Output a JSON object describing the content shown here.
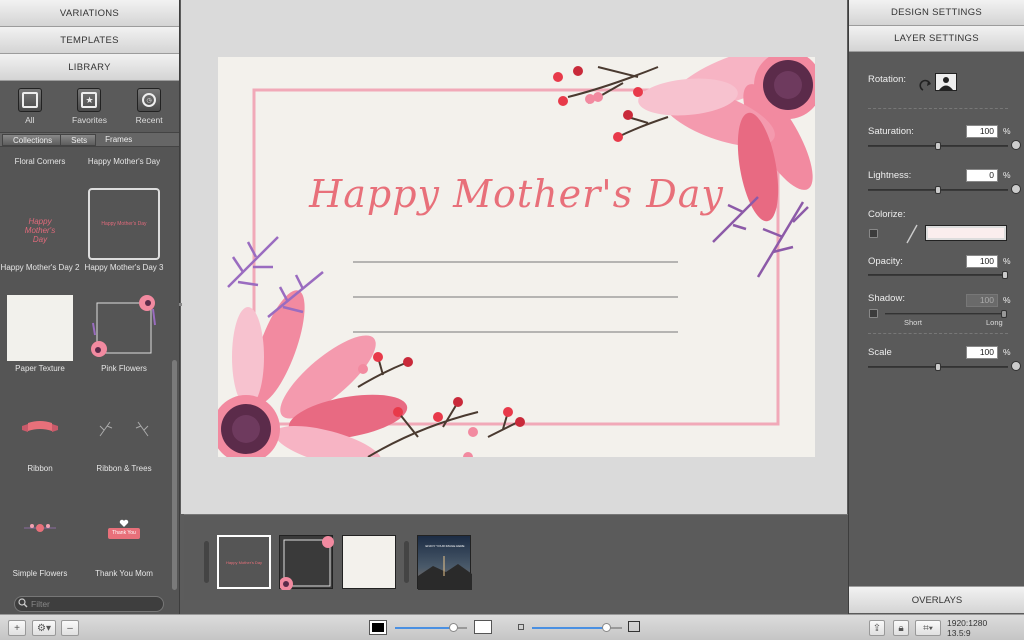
{
  "left_panel": {
    "tabs": [
      "VARIATIONS",
      "TEMPLATES",
      "LIBRARY"
    ],
    "library_filters": [
      {
        "label": "All",
        "icon": "square-icon"
      },
      {
        "label": "Favorites",
        "icon": "star-icon"
      },
      {
        "label": "Recent",
        "icon": "clock-icon"
      }
    ],
    "breadcrumb": [
      "Collections",
      "Sets",
      "Frames"
    ],
    "items": [
      {
        "label": "Floral Corners"
      },
      {
        "label": "Happy Mother's Day"
      },
      {
        "label": "Happy Mother's Day 2",
        "thumb_text": "Happy Mother's Day"
      },
      {
        "label": "Happy Mother's Day 3",
        "thumb_text": "Happy Mother's Day"
      },
      {
        "label": "Paper Texture"
      },
      {
        "label": "Pink Flowers"
      },
      {
        "label": "Ribbon"
      },
      {
        "label": "Ribbon & Trees"
      },
      {
        "label": "Simple Flowers"
      },
      {
        "label": "Thank You Mom",
        "thumb_text": "Thank You"
      }
    ],
    "filter_placeholder": "Filter"
  },
  "canvas": {
    "card_title": "Happy Mother's Day",
    "accent_color": "#e8707a"
  },
  "strip": {
    "last_thumb_text": "ENJOY YOUR IMAGE HERE"
  },
  "right_panel": {
    "tabs": [
      "DESIGN SETTINGS",
      "LAYER SETTINGS"
    ],
    "rotation_label": "Rotation:",
    "saturation": {
      "label": "Saturation:",
      "value": "100",
      "unit": "%",
      "level": 0.5
    },
    "lightness": {
      "label": "Lightness:",
      "value": "0",
      "unit": "%",
      "level": 0.5
    },
    "colorize": {
      "label": "Colorize:",
      "swatch": "#fbeeee"
    },
    "opacity": {
      "label": "Opacity:",
      "value": "100",
      "unit": "%",
      "level": 1.0
    },
    "shadow": {
      "label": "Shadow:",
      "value": "100",
      "unit": "%",
      "short": "Short",
      "long": "Long"
    },
    "scale": {
      "label": "Scale",
      "value": "100",
      "unit": "%",
      "level": 0.5
    },
    "overlays_label": "OVERLAYS"
  },
  "bottom_bar": {
    "resolution": "1920:1280",
    "ratio": "13.5:9"
  }
}
